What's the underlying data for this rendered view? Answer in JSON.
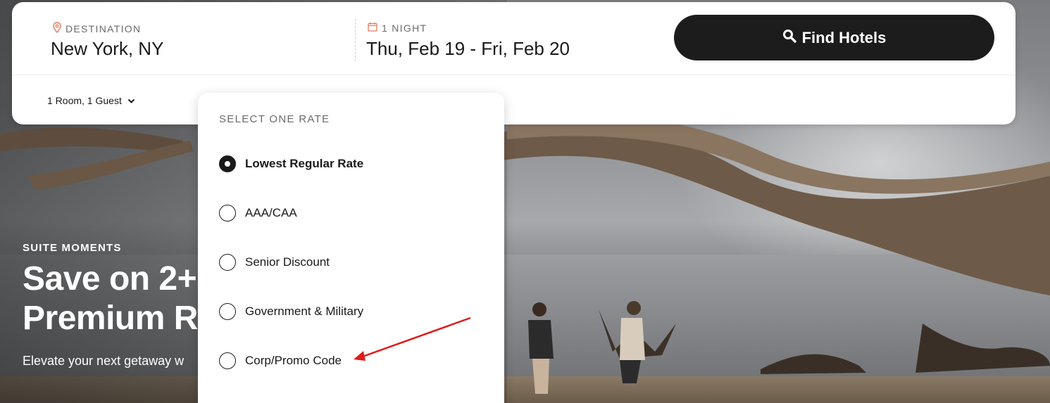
{
  "colors": {
    "button_bg": "#1c1c1c",
    "accent_icon": "#e07b5f",
    "arrow": "#e01b1b"
  },
  "search": {
    "destination_label": "DESTINATION",
    "destination_value": "New York, NY",
    "dates_label": "1 NIGHT",
    "dates_value": "Thu, Feb 19 - Fri, Feb 20",
    "find_button": "Find Hotels",
    "rooms_guests": "1 Room, 1 Guest",
    "icons": [
      "location-pin-icon",
      "calendar-icon",
      "search-icon",
      "chevron-down-icon"
    ]
  },
  "rate_panel": {
    "title": "SELECT ONE RATE",
    "selected": "Lowest Regular Rate",
    "options": [
      {
        "label": "Lowest Regular Rate"
      },
      {
        "label": "AAA/CAA"
      },
      {
        "label": "Senior Discount"
      },
      {
        "label": "Government & Military"
      },
      {
        "label": "Corp/Promo Code"
      }
    ]
  },
  "hero": {
    "eyebrow": "SUITE MOMENTS",
    "headline_line1": "Save on 2+",
    "headline_line2": "Premium R",
    "subcopy": "Elevate your next getaway w"
  }
}
